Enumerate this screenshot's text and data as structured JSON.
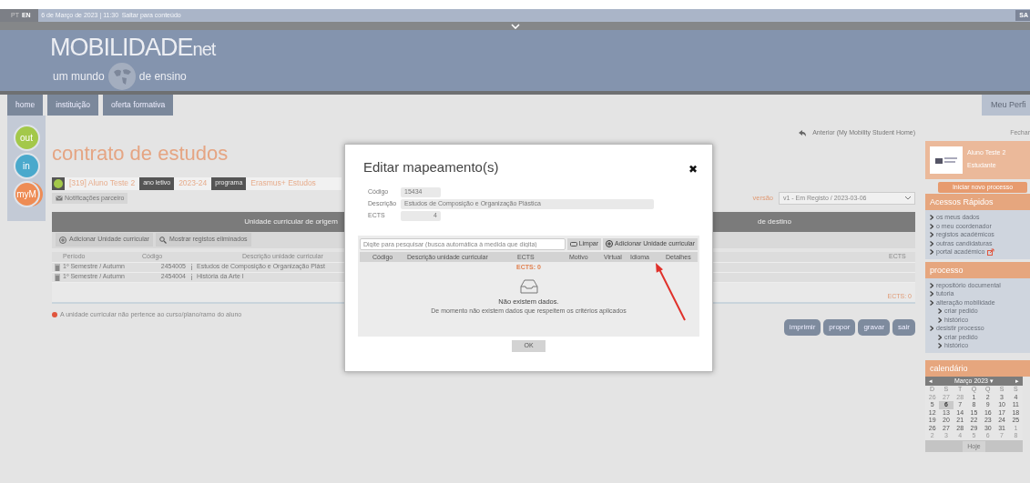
{
  "top_bar": {
    "languages": [
      {
        "label": "PT",
        "selected": false
      },
      {
        "label": "EN",
        "selected": true
      }
    ],
    "datetime": "6 de Março de 2023 | 11:30",
    "skip_link": "Saltar para conteúdo",
    "logout": "SA"
  },
  "banner": {
    "title": "MOBILIDADE",
    "title_suffix": "net",
    "tagline_start": "um mundo",
    "tagline_end": "de ensino"
  },
  "nav": {
    "items": [
      {
        "label": "home"
      },
      {
        "label": "instituição"
      },
      {
        "label": "oferta formativa"
      }
    ],
    "profile": "Meu Perfi"
  },
  "side_icons": [
    {
      "label": "out",
      "color": "#a3c84a",
      "selected": false
    },
    {
      "label": "in",
      "color": "#4aa9cc",
      "selected": false
    },
    {
      "label": "myM",
      "color": "#ee8c55",
      "selected": true
    }
  ],
  "page": {
    "back_link": "Anterior (My Mobility Student Home)",
    "title": "contrato de estudos",
    "student": "[319] Aluno Teste 2",
    "year_label": "ano letivo",
    "year": "2023-24",
    "program_label": "programa",
    "program": "Erasmus+ Estudos",
    "notifications": "Notificações parceiro",
    "version_label": "versão",
    "version": "v1 - Em Registo / 2023-03-06",
    "origin_header": "Unidade curricular de origem",
    "dest_header": "de destino",
    "add_button": "Adicionar Unidade curricular",
    "show_deleted": "Mostrar registos eliminados",
    "columns": [
      "Período",
      "Código",
      "Descrição unidade curricular"
    ],
    "dest_columns": [
      "ECTS"
    ],
    "rows": [
      {
        "period": "1º Semestre / Autumn",
        "code": "2454005",
        "description": "Estudos de Composição e Organização Plást"
      },
      {
        "period": "1º Semestre / Autumn",
        "code": "2454004",
        "description": "História da Arte I"
      }
    ],
    "ects_total": "ECTS: 0",
    "legend": "A unidade curricular não pertence ao curso/plano/ramo do aluno",
    "actions": [
      "imprimir",
      "propor",
      "gravar",
      "sair"
    ]
  },
  "modal": {
    "title": "Editar mapeamento(s)",
    "close": "✖",
    "fields": [
      {
        "label": "Código",
        "value": "15434",
        "kind": "short"
      },
      {
        "label": "Descrição",
        "value": "Estudos de Composição e Organização Plástica",
        "kind": "wide"
      },
      {
        "label": "ECTS",
        "value": "4",
        "kind": "number"
      }
    ],
    "search_placeholder": "Digite para pesquisar (busca automática à medida que digita)",
    "clear_button": "Limpar",
    "add_button": "Adicionar Unidade curricular",
    "columns": [
      "Código",
      "Descrição unidade curricular",
      "ECTS",
      "Motivo",
      "Virtual",
      "Idioma",
      "Detalhes"
    ],
    "ects_total": "ECTS: 0",
    "empty_title": "Não existem dados.",
    "empty_text": "De momento não existem dados que respeitem os critérios aplicados",
    "ok_button": "OK"
  },
  "sidebar": {
    "close_link": "Fechar",
    "profile": {
      "name": "Aluno Teste 2",
      "role": "Estudante"
    },
    "start_button": "Iniciar novo processo",
    "quick_access": {
      "title": "Acessos Rápidos",
      "items": [
        {
          "label": "os meus dados",
          "external": false
        },
        {
          "label": "o meu coordenador",
          "external": false
        },
        {
          "label": "registos académicos",
          "external": false
        },
        {
          "label": "outras candidaturas",
          "external": false
        },
        {
          "label": "portal académico",
          "external": true
        }
      ]
    },
    "process": {
      "title": "processo",
      "items": [
        {
          "label": "repositório documental"
        },
        {
          "label": "tutoria"
        },
        {
          "label": "alteração mobilidade",
          "children": [
            {
              "label": "criar pedido"
            },
            {
              "label": "histórico"
            }
          ]
        },
        {
          "label": "desistir processo",
          "children": [
            {
              "label": "criar pedido"
            },
            {
              "label": "histórico"
            }
          ]
        }
      ]
    },
    "calendar": {
      "title": "calendário",
      "prev": "◂",
      "month": "Março 2023 ▾",
      "next": "▸",
      "weekdays": [
        "D",
        "S",
        "T",
        "Q",
        "Q",
        "S",
        "S"
      ],
      "weeks": [
        [
          {
            "d": "26",
            "muted": true,
            "selected": false
          },
          {
            "d": "27",
            "muted": true,
            "selected": false
          },
          {
            "d": "28",
            "muted": true,
            "selected": false
          },
          {
            "d": "1",
            "muted": false,
            "selected": false
          },
          {
            "d": "2",
            "muted": false,
            "selected": false
          },
          {
            "d": "3",
            "muted": false,
            "selected": false
          },
          {
            "d": "4",
            "muted": false,
            "selected": false
          }
        ],
        [
          {
            "d": "5",
            "muted": false,
            "selected": false
          },
          {
            "d": "6",
            "muted": false,
            "selected": true
          },
          {
            "d": "7",
            "muted": false,
            "selected": false
          },
          {
            "d": "8",
            "muted": false,
            "selected": false
          },
          {
            "d": "9",
            "muted": false,
            "selected": false
          },
          {
            "d": "10",
            "muted": false,
            "selected": false
          },
          {
            "d": "11",
            "muted": false,
            "selected": false
          }
        ],
        [
          {
            "d": "12",
            "muted": false,
            "selected": false
          },
          {
            "d": "13",
            "muted": false,
            "selected": false
          },
          {
            "d": "14",
            "muted": false,
            "selected": false
          },
          {
            "d": "15",
            "muted": false,
            "selected": false
          },
          {
            "d": "16",
            "muted": false,
            "selected": false
          },
          {
            "d": "17",
            "muted": false,
            "selected": false
          },
          {
            "d": "18",
            "muted": false,
            "selected": false
          }
        ],
        [
          {
            "d": "19",
            "muted": false,
            "selected": false
          },
          {
            "d": "20",
            "muted": false,
            "selected": false
          },
          {
            "d": "21",
            "muted": false,
            "selected": false
          },
          {
            "d": "22",
            "muted": false,
            "selected": false
          },
          {
            "d": "23",
            "muted": false,
            "selected": false
          },
          {
            "d": "24",
            "muted": false,
            "selected": false
          },
          {
            "d": "25",
            "muted": false,
            "selected": false
          }
        ],
        [
          {
            "d": "26",
            "muted": false,
            "selected": false
          },
          {
            "d": "27",
            "muted": false,
            "selected": false
          },
          {
            "d": "28",
            "muted": false,
            "selected": false
          },
          {
            "d": "29",
            "muted": false,
            "selected": false
          },
          {
            "d": "30",
            "muted": false,
            "selected": false
          },
          {
            "d": "31",
            "muted": false,
            "selected": false
          },
          {
            "d": "1",
            "muted": true,
            "selected": false
          }
        ],
        [
          {
            "d": "2",
            "muted": true,
            "selected": false
          },
          {
            "d": "3",
            "muted": true,
            "selected": false
          },
          {
            "d": "4",
            "muted": true,
            "selected": false
          },
          {
            "d": "5",
            "muted": true,
            "selected": false
          },
          {
            "d": "6",
            "muted": true,
            "selected": false
          },
          {
            "d": "7",
            "muted": true,
            "selected": false
          },
          {
            "d": "8",
            "muted": true,
            "selected": false
          }
        ]
      ],
      "today": "Hoje"
    }
  }
}
